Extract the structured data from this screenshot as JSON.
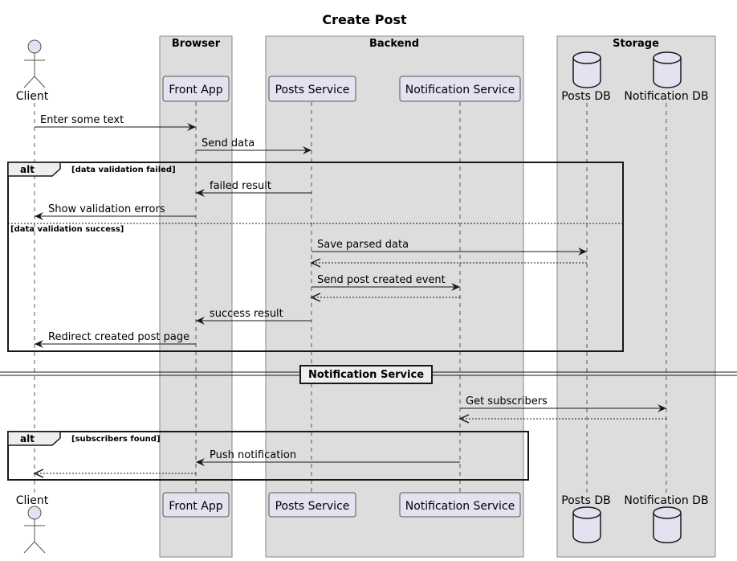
{
  "title": "Create Post",
  "colors": {
    "box_fill": "#dddddd",
    "box_stroke": "#888888",
    "participant_fill": "#e2e2f0",
    "participant_stroke": "#555555",
    "line": "#181818",
    "background": "#ffffff"
  },
  "boxes": [
    {
      "id": "browser",
      "label": "Browser"
    },
    {
      "id": "backend",
      "label": "Backend"
    },
    {
      "id": "storage",
      "label": "Storage"
    }
  ],
  "participants": [
    {
      "id": "client",
      "label": "Client",
      "kind": "actor"
    },
    {
      "id": "front",
      "label": "Front App",
      "kind": "participant"
    },
    {
      "id": "posts",
      "label": "Posts Service",
      "kind": "participant"
    },
    {
      "id": "notif",
      "label": "Notification Service",
      "kind": "participant"
    },
    {
      "id": "postsdb",
      "label": "Posts DB",
      "kind": "database"
    },
    {
      "id": "notifdb",
      "label": "Notification DB",
      "kind": "database"
    }
  ],
  "messages": [
    {
      "from": "client",
      "to": "front",
      "label": "Enter some text",
      "style": "solid"
    },
    {
      "from": "front",
      "to": "posts",
      "label": "Send data",
      "style": "solid"
    },
    {
      "from": "posts",
      "to": "front",
      "label": "failed result",
      "style": "solid"
    },
    {
      "from": "front",
      "to": "client",
      "label": "Show validation errors",
      "style": "solid"
    },
    {
      "from": "posts",
      "to": "postsdb",
      "label": "Save parsed data",
      "style": "solid"
    },
    {
      "from": "postsdb",
      "to": "posts",
      "label": "",
      "style": "dashed"
    },
    {
      "from": "posts",
      "to": "notif",
      "label": "Send post created event",
      "style": "solid"
    },
    {
      "from": "notif",
      "to": "posts",
      "label": "",
      "style": "dashed"
    },
    {
      "from": "posts",
      "to": "front",
      "label": "success result",
      "style": "solid"
    },
    {
      "from": "front",
      "to": "client",
      "label": "Redirect created post page",
      "style": "solid"
    },
    {
      "from": "notif",
      "to": "notifdb",
      "label": "Get subscribers",
      "style": "solid"
    },
    {
      "from": "notifdb",
      "to": "notif",
      "label": "",
      "style": "dashed"
    },
    {
      "from": "notif",
      "to": "front",
      "label": "Push notification",
      "style": "solid"
    },
    {
      "from": "front",
      "to": "client",
      "label": "",
      "style": "dashed"
    }
  ],
  "fragments": [
    {
      "type": "alt",
      "label": "alt",
      "guard": "[data validation failed]",
      "else_guard": "[data validation success]"
    },
    {
      "type": "alt",
      "label": "alt",
      "guard": "[subscribers found]"
    }
  ],
  "divider": {
    "label": "Notification Service"
  }
}
